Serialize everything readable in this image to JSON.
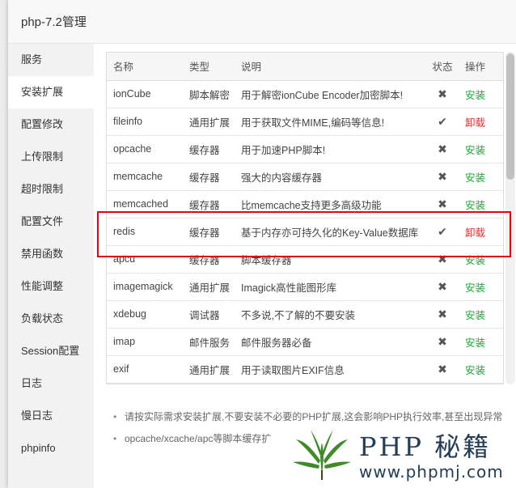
{
  "dialog": {
    "title": "php-7.2管理"
  },
  "sidebar": {
    "items": [
      {
        "label": "服务"
      },
      {
        "label": "安装扩展"
      },
      {
        "label": "配置修改"
      },
      {
        "label": "上传限制"
      },
      {
        "label": "超时限制"
      },
      {
        "label": "配置文件"
      },
      {
        "label": "禁用函数"
      },
      {
        "label": "性能调整"
      },
      {
        "label": "负载状态"
      },
      {
        "label": "Session配置"
      },
      {
        "label": "日志"
      },
      {
        "label": "慢日志"
      },
      {
        "label": "phpinfo"
      }
    ],
    "active_index": 1
  },
  "table": {
    "headers": {
      "name": "名称",
      "type": "类型",
      "desc": "说明",
      "status": "状态",
      "action": "操作"
    },
    "rows": [
      {
        "name": "ionCube",
        "type": "脚本解密",
        "desc": "用于解密ionCube Encoder加密脚本!",
        "status_icon": "cross-icon",
        "action": "安装"
      },
      {
        "name": "fileinfo",
        "type": "通用扩展",
        "desc": "用于获取文件MIME,编码等信息!",
        "status_icon": "check-icon",
        "action": "卸载"
      },
      {
        "name": "opcache",
        "type": "缓存器",
        "desc": "用于加速PHP脚本!",
        "status_icon": "cross-icon",
        "action": "安装"
      },
      {
        "name": "memcache",
        "type": "缓存器",
        "desc": "强大的内容缓存器",
        "status_icon": "cross-icon",
        "action": "安装"
      },
      {
        "name": "memcached",
        "type": "缓存器",
        "desc": "比memcache支持更多高级功能",
        "status_icon": "cross-icon",
        "action": "安装"
      },
      {
        "name": "redis",
        "type": "缓存器",
        "desc": "基于内存亦可持久化的Key-Value数据库",
        "status_icon": "check-icon",
        "action": "卸载"
      },
      {
        "name": "apcu",
        "type": "缓存器",
        "desc": "脚本缓存器",
        "status_icon": "cross-icon",
        "action": "安装"
      },
      {
        "name": "imagemagick",
        "type": "通用扩展",
        "desc": "Imagick高性能图形库",
        "status_icon": "cross-icon",
        "action": "安装"
      },
      {
        "name": "xdebug",
        "type": "调试器",
        "desc": "不多说,不了解的不要安装",
        "status_icon": "cross-icon",
        "action": "安装"
      },
      {
        "name": "imap",
        "type": "邮件服务",
        "desc": "邮件服务器必备",
        "status_icon": "cross-icon",
        "action": "安装"
      },
      {
        "name": "exif",
        "type": "通用扩展",
        "desc": "用于读取图片EXIF信息",
        "status_icon": "cross-icon",
        "action": "安装"
      }
    ]
  },
  "notes": [
    "请按实际需求安装扩展,不要安装不必要的PHP扩展,这会影响PHP执行效率,甚至出现异常",
    "opcache/xcache/apc等脚本缓存扩"
  ],
  "watermark": {
    "title": "PHP 秘籍",
    "url": "www.phpmj.com"
  },
  "colors": {
    "install": "#20a53a",
    "uninstall": "#e12f2f",
    "highlight": "#e60012"
  }
}
